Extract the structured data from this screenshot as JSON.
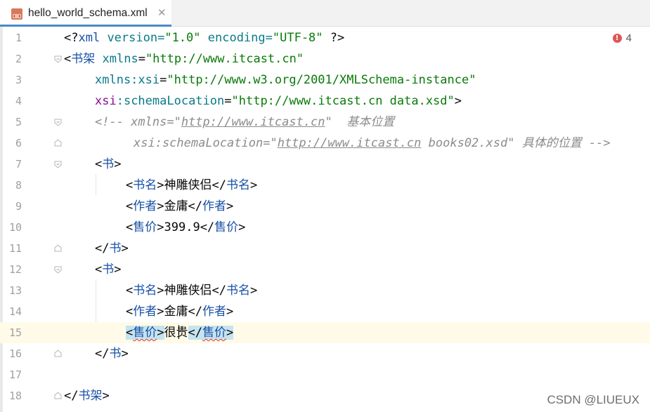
{
  "tab": {
    "label": "hello_world_schema.xml",
    "close": "✕"
  },
  "problems": {
    "count": "4",
    "icon": "error-icon"
  },
  "lines": {
    "l1": [
      "<?",
      "xml",
      " version=",
      "\"1.0\"",
      " encoding=",
      "\"UTF-8\"",
      " ?>"
    ],
    "l2": [
      "<",
      "书架",
      " ",
      "xmlns",
      "=",
      "\"http://www.itcast.cn\""
    ],
    "l3": [
      "xmlns:xsi",
      "=",
      "\"http://www.w3.org/2001/XMLSchema-instance\""
    ],
    "l4": [
      "xsi",
      ":schemaLocation",
      "=",
      "\"http://www.itcast.cn data.xsd\"",
      ">"
    ],
    "l5": [
      "<!-- xmlns=\"",
      "http://www.itcast.cn",
      "\"  基本位置"
    ],
    "l6": [
      "xsi:schemaLocation=\"",
      "http://www.itcast.cn",
      " books02.xsd\" 具体的位置 -->"
    ],
    "l7": [
      "<",
      "书",
      ">"
    ],
    "l8": [
      "<",
      "书名",
      ">",
      "神雕侠侣",
      "</",
      "书名",
      ">"
    ],
    "l9": [
      "<",
      "作者",
      ">",
      "金庸",
      "</",
      "作者",
      ">"
    ],
    "l10": [
      "<",
      "售价",
      ">",
      "399.9",
      "</",
      "售价",
      ">"
    ],
    "l11": [
      "</",
      "书",
      ">"
    ],
    "l12": [
      "<",
      "书",
      ">"
    ],
    "l13": [
      "<",
      "书名",
      ">",
      "神雕侠侣",
      "</",
      "书名",
      ">"
    ],
    "l14": [
      "<",
      "作者",
      ">",
      "金庸",
      "</",
      "作者",
      ">"
    ],
    "l15": [
      "<",
      "售价",
      ">",
      "很贵",
      "</",
      "售价",
      ">"
    ],
    "l16": [
      "</",
      "书",
      ">"
    ],
    "l18": [
      "</",
      "书架",
      ">"
    ]
  },
  "line_numbers": [
    "1",
    "2",
    "3",
    "4",
    "5",
    "6",
    "7",
    "8",
    "9",
    "10",
    "11",
    "12",
    "13",
    "14",
    "15",
    "16",
    "17",
    "18"
  ],
  "watermark": "CSDN @LIUEUX",
  "colors": {
    "tag": "#1750a6",
    "attr": "#0a7a8a",
    "string": "#0a7a0a",
    "comment": "#8c8c8c",
    "namespace": "#871094",
    "current_line": "#fffbe8",
    "tag_highlight": "#c5e3f0"
  }
}
